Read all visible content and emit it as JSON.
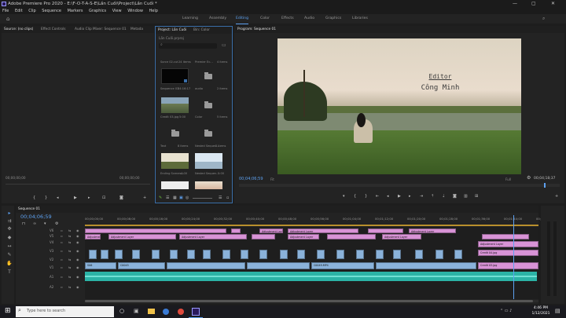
{
  "window": {
    "title": "Adobe Premiere Pro 2020 - E:\\F-O-T-A-S-E\\Lần Cuối\\Project\\Lần Cuối *",
    "controls": [
      "—",
      "▢",
      "✕"
    ]
  },
  "menu": [
    "File",
    "Edit",
    "Clip",
    "Sequence",
    "Markers",
    "Graphics",
    "View",
    "Window",
    "Help"
  ],
  "workspaces": [
    "Learning",
    "Assembly",
    "Editing",
    "Color",
    "Effects",
    "Audio",
    "Graphics",
    "Libraries"
  ],
  "active_workspace": "Editing",
  "source_panel": {
    "tabs": [
      "Source: (no clips)",
      "Effect Controls",
      "Audio Clip Mixer: Sequence 01",
      "Metada"
    ],
    "timecode_left": "00;00;00;00",
    "timecode_right": "00;00;00;00"
  },
  "project_panel": {
    "tabs": [
      "Project: Lần Cuối",
      "Bin: Color"
    ],
    "path": "Lần Cuối.prproj",
    "items": [
      {
        "name": "Sorce 02.cut",
        "meta": "24 items"
      },
      {
        "name": "Premier Ec...",
        "meta": "4 items"
      },
      {
        "name": "Sequence 01",
        "meta": "04:16:17"
      },
      {
        "name": "audio",
        "meta": "2 items"
      },
      {
        "name": "Credit 03.jpg",
        "meta": "5:00"
      },
      {
        "name": "Color",
        "meta": "5 items"
      },
      {
        "name": "Text",
        "meta": "8 items"
      },
      {
        "name": "Nested Sequen...",
        "meta": "2 items"
      },
      {
        "name": "Ending Scenes...",
        "meta": "4:00"
      },
      {
        "name": "Nested Sequen...",
        "meta": "5:00"
      }
    ]
  },
  "program_panel": {
    "title": "Program: Sequence 01",
    "overlay_title": "Editor",
    "overlay_name": "Công Minh",
    "timecode": "00;04;06;59",
    "fit": "Fit",
    "quality": "Full",
    "duration": "00;04;18;37"
  },
  "timeline": {
    "tab": "Sequence 01",
    "timecode": "00;04;06;59",
    "ruler": [
      "00;00;00;00",
      "00;00;08;00",
      "00;00;16;00",
      "00;00;24;00",
      "00;00;32;00",
      "00;00;40;00",
      "00;00;48;00",
      "00;00;56;00",
      "00;01;04;00",
      "00;01;12;00",
      "00;01;20;00",
      "00;01;28;00",
      "00;01;36;00",
      "00;01;44;00",
      "00;01;52;00"
    ],
    "tracks": [
      "V6",
      "V5",
      "V4",
      "V3",
      "V2",
      "V1",
      "A1",
      "A2"
    ],
    "clip_labels": {
      "adjustment": "Adjustment Layer",
      "credit": "Credit 03.jpg",
      "credit_b": "Credit 04.jpg",
      "c1": "C0045",
      "c2": "C0049.MP4",
      "s": "S06"
    }
  },
  "taskbar": {
    "search_placeholder": "Type here to search",
    "time": "4:46 PM",
    "date": "1/12/2021"
  },
  "colors": {
    "accent": "#5da1f0",
    "adjustment_clip": "#d893d6",
    "video_clip": "#8ab2da",
    "audio_clip": "#3cbfb2"
  }
}
